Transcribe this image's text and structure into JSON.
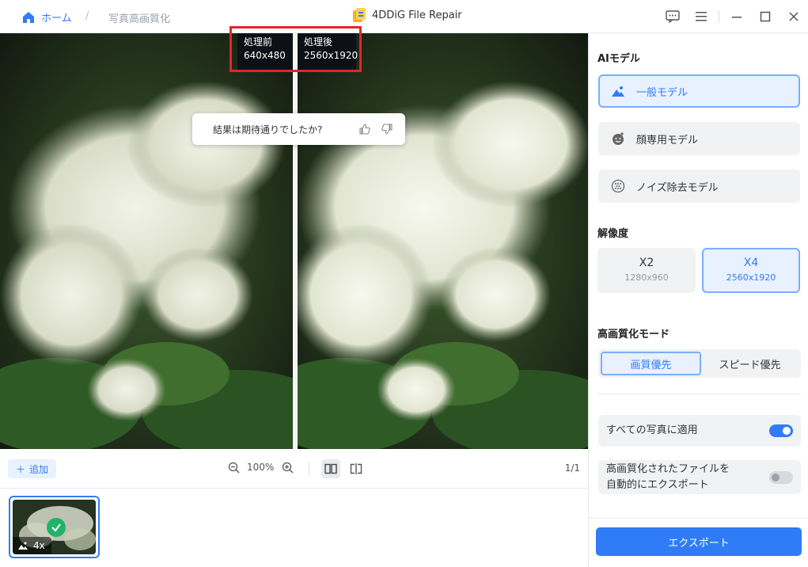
{
  "titlebar": {
    "home_label": "ホーム",
    "breadcrumb_separator": "/",
    "breadcrumb_current": "写真高画質化",
    "app_title": "4DDiG File Repair"
  },
  "preview": {
    "before_label": "処理前",
    "before_size": "640x480",
    "after_label": "処理後",
    "after_size": "2560x1920",
    "feedback_question": "結果は期待通りでしたか?"
  },
  "toolbar": {
    "add_label": "追加",
    "zoom_level": "100%",
    "page_count": "1/1"
  },
  "thumbnails": [
    {
      "badge": "4x",
      "selected": true,
      "done": true
    }
  ],
  "panel": {
    "ai_model_title": "AIモデル",
    "models": [
      {
        "label": "一般モデル",
        "icon": "landscape-icon",
        "active": true
      },
      {
        "label": "顔専用モデル",
        "icon": "face-icon",
        "active": false
      },
      {
        "label": "ノイズ除去モデル",
        "icon": "noise-icon",
        "active": false
      }
    ],
    "resolution_title": "解像度",
    "resolutions": [
      {
        "label": "X2",
        "size": "1280x960",
        "active": false
      },
      {
        "label": "X4",
        "size": "2560x1920",
        "active": true
      }
    ],
    "mode_title": "高画質化モード",
    "modes": [
      {
        "label": "画質優先",
        "active": true
      },
      {
        "label": "スピード優先",
        "active": false
      }
    ],
    "apply_all_label": "すべての写真に適用",
    "apply_all_on": true,
    "auto_export_label_line1": "高画質化されたファイルを",
    "auto_export_label_line2": "自動的にエクスポート",
    "auto_export_on": false,
    "export_label": "エクスポート"
  },
  "colors": {
    "accent": "#2f7cf6",
    "highlight_border": "#e0262b",
    "success": "#20b26b"
  }
}
